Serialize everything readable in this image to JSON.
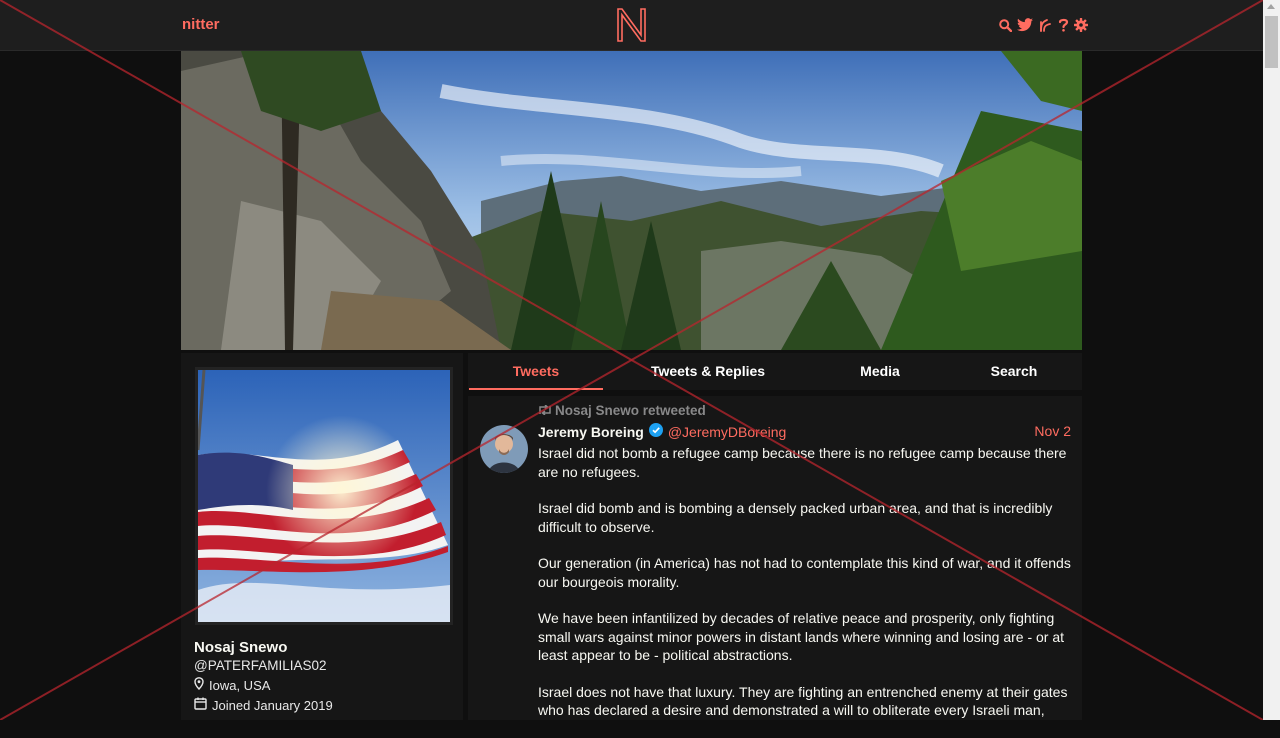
{
  "nav": {
    "brand": "nitter",
    "logo_letter": "N",
    "icons": [
      "search-icon",
      "twitter-bird-icon",
      "rss-icon",
      "help-icon",
      "gear-icon"
    ]
  },
  "tabs": [
    {
      "label": "Tweets",
      "active": true
    },
    {
      "label": "Tweets & Replies",
      "active": false
    },
    {
      "label": "Media",
      "active": false
    },
    {
      "label": "Search",
      "active": false
    }
  ],
  "profile": {
    "name": "Nosaj Snewo",
    "handle": "@PATERFAMILIAS02",
    "location": "Iowa, USA",
    "joined": "Joined January 2019"
  },
  "tweet": {
    "retweet_header": "Nosaj Snewo retweeted",
    "author_name": "Jeremy Boreing",
    "author_handle": "@JeremyDBoreing",
    "date": "Nov 2",
    "paragraphs": [
      "Israel did not bomb a refugee camp because there is no refugee camp because there are no refugees.",
      "Israel did bomb and is bombing a densely packed urban area, and that is incredibly difficult to observe.",
      "Our generation (in America) has not had to contemplate this kind of war, and it offends our bourgeois morality.",
      "We have been infantilized by decades of relative peace and prosperity, only fighting small wars against minor powers in distant lands where winning and losing are - or at least appear to be - political abstractions.",
      "Israel does not have that luxury. They are fighting an entrenched enemy at their gates who has declared a desire and demonstrated a will to obliterate every Israeli man,"
    ]
  },
  "colors": {
    "accent": "#ff6c60",
    "background": "#0f0f0f",
    "panel": "#161616",
    "navbar": "#1e1e1e",
    "overlay_x": "#b8262e"
  }
}
